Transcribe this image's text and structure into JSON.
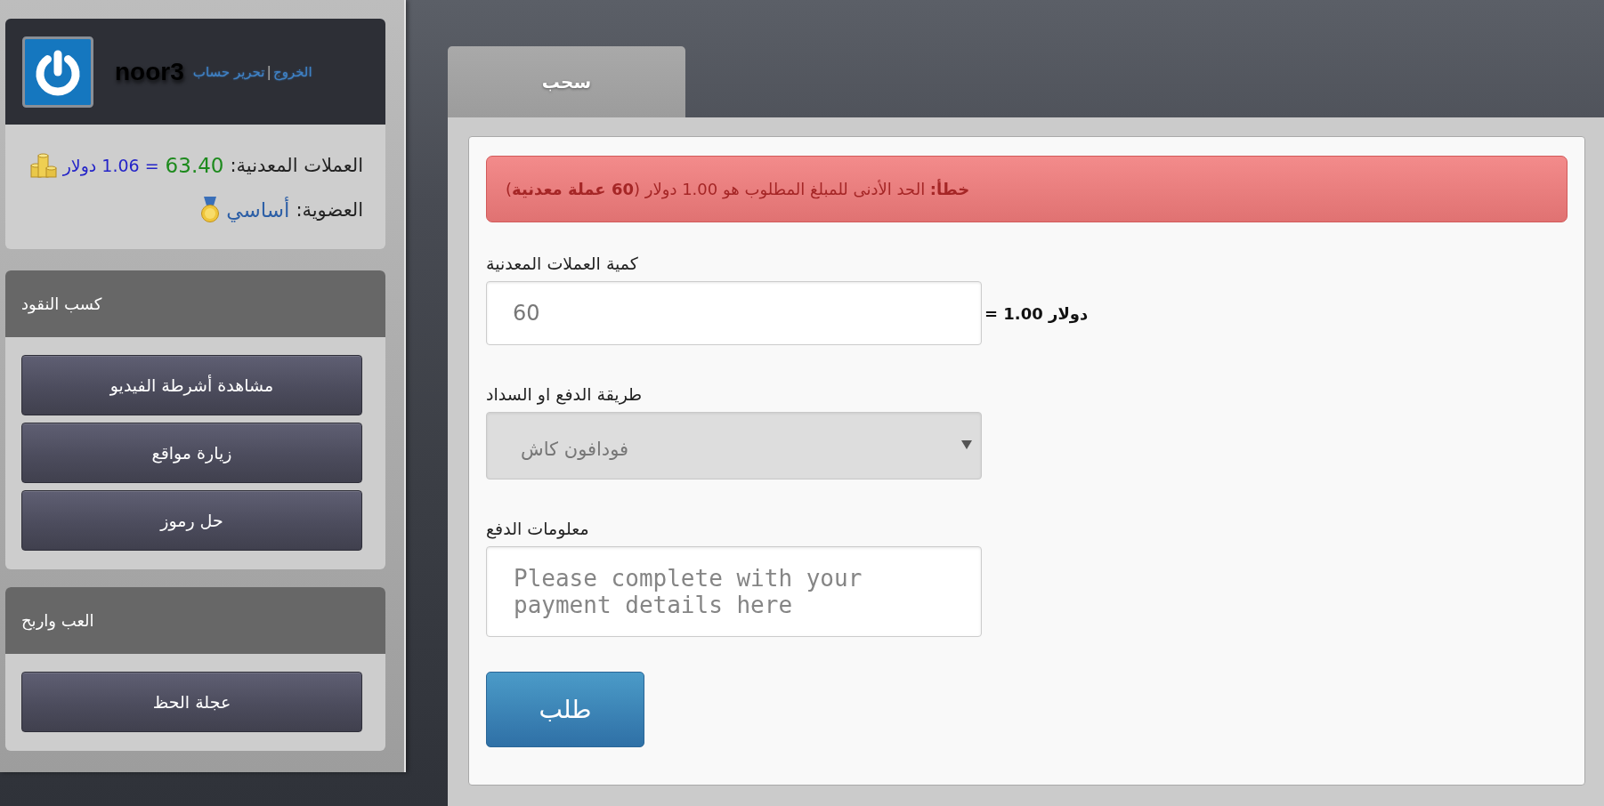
{
  "sidebar": {
    "user": {
      "username": "noor3",
      "links": [
        "الخروج",
        "تحرير حساب"
      ],
      "link_separator": "|"
    },
    "stats": [
      {
        "kind": "coins",
        "label": "العملات المعدنية:",
        "value": "63.40",
        "conversion": "= 1.06 دولار"
      },
      {
        "kind": "membership",
        "label": "العضوية:",
        "value": "أساسي"
      }
    ],
    "sections": [
      {
        "title": "كسب النقود",
        "buttons": [
          "مشاهدة أشرطة الفيديو",
          "زيارة مواقع",
          "حل رموز"
        ]
      },
      {
        "title": "العب واربح",
        "buttons": [
          "عجلة الحظ"
        ]
      }
    ]
  },
  "tabs": [
    {
      "label": "سحب",
      "selected": true
    }
  ],
  "alert": {
    "kind": "error",
    "text": "**خطأ:** الحد الأدنى للمبلغ المطلوب هو 1.00 دولار (**60 عملة معدنية**)"
  },
  "form": {
    "fields": [
      {
        "kind": "number",
        "label": "كمية العملات المعدنية",
        "value": "60",
        "suffix": "= 1.00 دولار"
      },
      {
        "kind": "select",
        "label": "طريقة الدفع او السداد",
        "value": "فودافون كاش"
      },
      {
        "kind": "textarea",
        "label": "معلومات الدفع",
        "placeholder": "Please complete with your payment details here"
      }
    ],
    "submit": "طلب"
  }
}
